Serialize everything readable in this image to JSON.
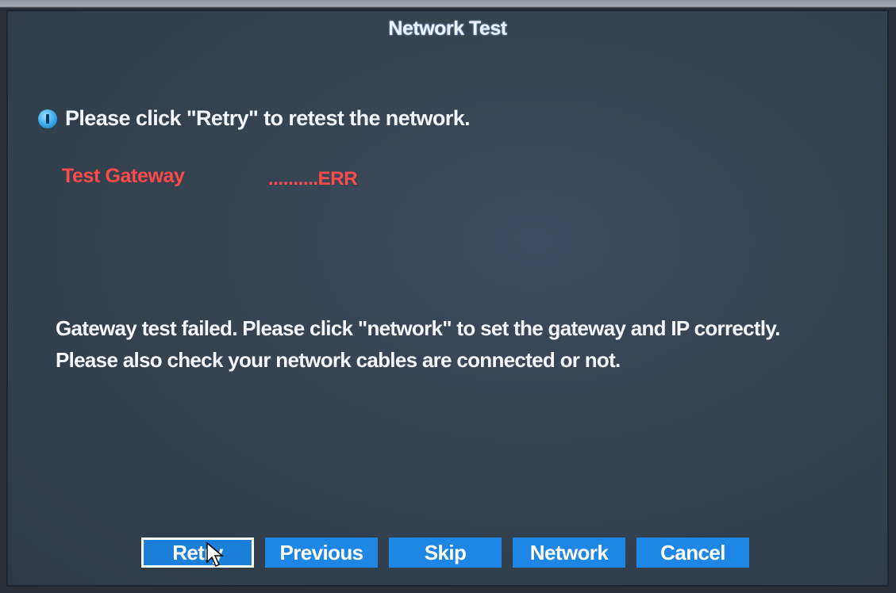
{
  "dialog": {
    "title": "Network Test",
    "info_icon": "info-icon",
    "info_message": "Please click \"Retry\" to retest the network.",
    "test_item": {
      "label": "Test Gateway",
      "result": "..........ERR"
    },
    "message_lines": [
      "Gateway test failed. Please click \"network\" to set the gateway and IP correctly.",
      "Please also check your network cables are connected or not."
    ]
  },
  "buttons": {
    "retry": "Retry",
    "previous": "Previous",
    "skip": "Skip",
    "network": "Network",
    "cancel": "Cancel"
  },
  "colors": {
    "background": "#34424f",
    "accent_button": "#1e86e5",
    "error_text": "#ff4a4a",
    "text": "#ffffff"
  }
}
